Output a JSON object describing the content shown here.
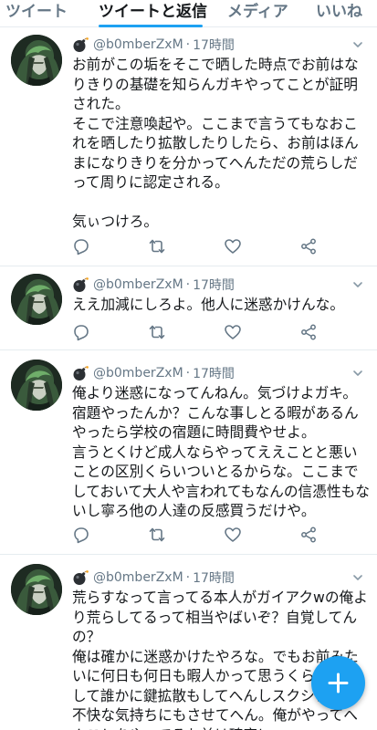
{
  "tabs": [
    {
      "label": "ツイート",
      "active": false
    },
    {
      "label": "ツイートと返信",
      "active": true
    },
    {
      "label": "メディア",
      "active": false
    },
    {
      "label": "いいね",
      "active": false
    }
  ],
  "author": {
    "handle": "@b0mberZxM",
    "name_icon": "bomb-icon"
  },
  "tweets": [
    {
      "time": "17時間",
      "text": "お前がこの垢をそこで晒した時点でお前はなりきりの基礎を知らんガキやってことが証明された。\nそこで注意喚起や。ここまで言うてもなおこれを晒したり拡散したりしたら、お前はほんまになりきりを分かってへんただの荒らしだって周りに認定される。\n\n気ぃつけろ。"
    },
    {
      "time": "17時間",
      "text": "ええ加減にしろよ。他人に迷惑かけんな。"
    },
    {
      "time": "17時間",
      "text": "俺より迷惑になってんねん。気づけよガキ。\n宿題やったんか？こんな事しとる暇があるんやったら学校の宿題に時間費やせよ。\n言うとくけど成人ならやってええことと悪いことの区別くらいついとるからな。ここまでしておいて大人や言われてもなんの信憑性もないし寧ろ他の人達の反感買うだけや。"
    },
    {
      "time": "17時間",
      "text": "荒らすなって言ってる本人がガイアクwの俺より荒らしてるって相当やばいぞ？自覚してんの？\n俺は確かに迷惑かけたやろな。でもお前みたいに何日も何日も暇人かって思うくらい監視して誰かに鍵拡散もしてへんしスクショして不快な気持ちにもさせてへん。俺がやってへんことをやってるお前は確実に"
    }
  ],
  "colors": {
    "accent": "#1da1f2",
    "text": "#14171a",
    "muted": "#657786",
    "divider": "#e6ecf0"
  }
}
